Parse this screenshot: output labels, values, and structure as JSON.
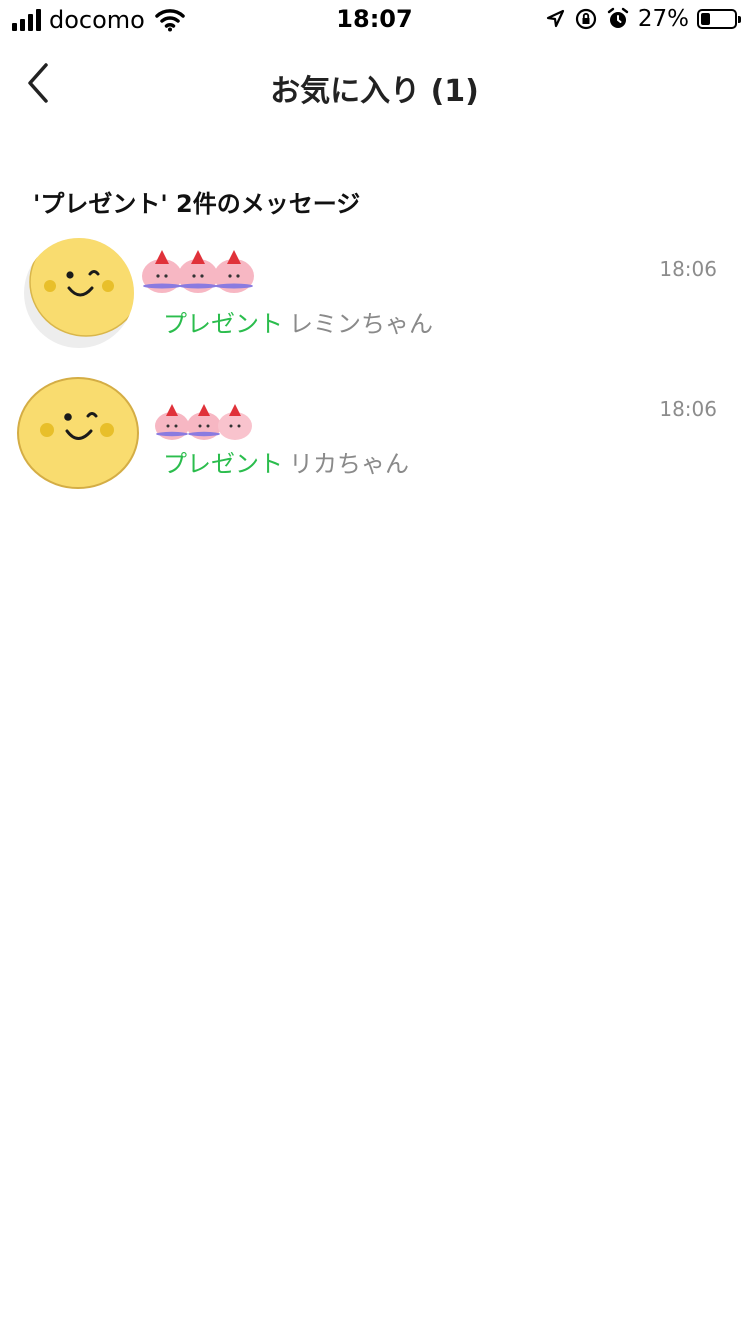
{
  "status_bar": {
    "carrier": "docomo",
    "time": "18:07",
    "battery_percent": "27%",
    "battery_level": 0.27
  },
  "nav": {
    "title": "お気に入り (1)"
  },
  "results": {
    "header": "'プレゼント' 2件のメッセージ",
    "items": [
      {
        "keyword": "プレゼント",
        "sender": "レミンちゃん",
        "time": "18:06"
      },
      {
        "keyword": "プレゼント",
        "sender": "リカちゃん",
        "time": "18:06"
      }
    ]
  },
  "colors": {
    "keyword": "#2bbd4d",
    "avatar_yellow": "#f9dc6f",
    "sticker_pink": "#f7b7c3",
    "sticker_hat": "#e0323a"
  }
}
